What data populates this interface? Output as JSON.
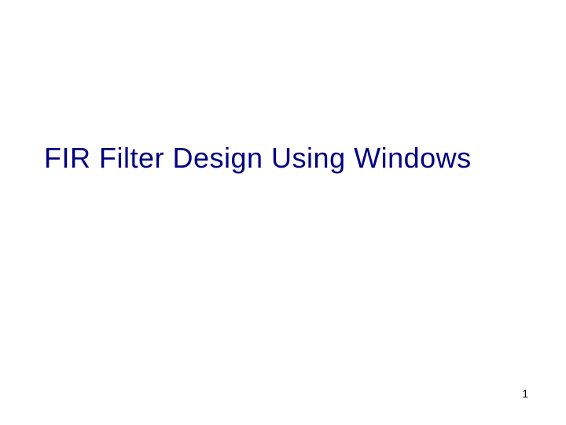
{
  "slide": {
    "title": "FIR Filter Design Using Windows",
    "page_number": "1"
  }
}
